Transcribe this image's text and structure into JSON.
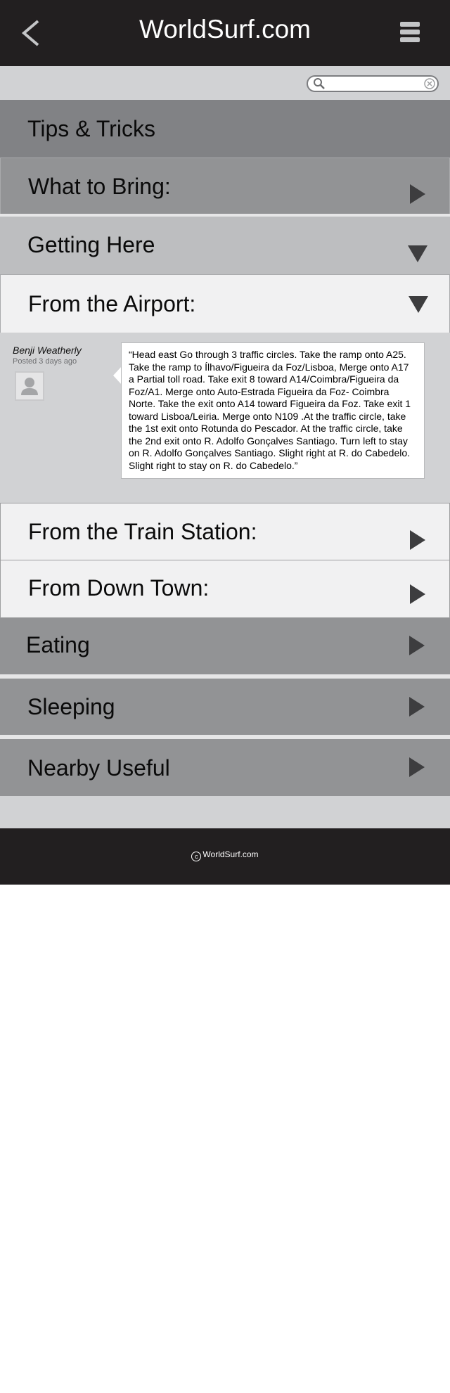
{
  "header": {
    "title": "WorldSurf.com",
    "back_icon": "chevron-left-icon",
    "menu_icon": "hamburger-menu-icon"
  },
  "search": {
    "placeholder": "",
    "value": ""
  },
  "page_title": "Tips & Tricks",
  "sections": {
    "what_to_bring": "What to Bring:",
    "getting_here": "Getting Here",
    "from_airport": "From the Airport:",
    "from_train": "From the Train Station:",
    "from_downtown": "From Down Town:",
    "eating": "Eating",
    "sleeping": "Sleeping",
    "nearby_useful": "Nearby Useful"
  },
  "comment": {
    "author": "Benji Weatherly",
    "posted": "Posted 3 days ago",
    "text": "“Head east Go through 3 traffic circles. Take the ramp onto A25. Take the ramp to Ílhavo/Figueira da Foz/Lisboa, Merge onto A17 a Partial toll road. Take exit 8 toward A14/Coimbra/Figueira da Foz/A1. Merge onto Auto-Estrada Figueira da Foz- Coimbra Norte. Take the exit onto A14 toward Figueira da Foz. Take exit 1 toward Lisboa/Leiria. Merge onto N109 .At the traffic circle, take the 1st exit onto Rotunda do Pescador. At the traffic circle, take the 2nd exit onto R. Adolfo Gonçalves Santiago. Turn left to stay on R. Adolfo Gonçalves Santiago. Slight right at R. do Cabedelo. Slight right to stay on R. do Cabedelo.”"
  },
  "footer": {
    "text": "WorldSurf.com",
    "symbol": "c"
  },
  "colors": {
    "header_bg": "#221f20",
    "strip_bg": "#d1d2d4",
    "dark_row": "#818285",
    "mid_row": "#929395",
    "light_row": "#bdbec0",
    "open_row": "#f1f1f2"
  }
}
